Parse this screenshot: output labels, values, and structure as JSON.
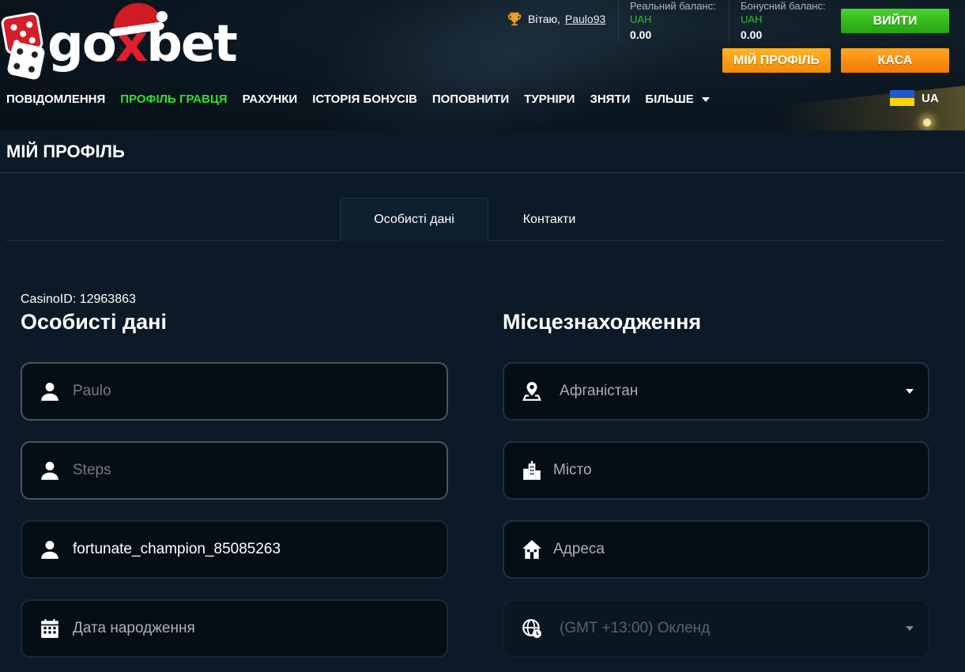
{
  "brand": {
    "name_left": "go",
    "name_x": "x",
    "name_right": "bet"
  },
  "header": {
    "greeting": "Вітаю,",
    "username": "Paulo93",
    "real_balance": {
      "label": "Реальний баланс:",
      "currency": "UAH",
      "amount": "0.00"
    },
    "bonus_balance": {
      "label": "Бонусний баланс:",
      "currency": "UAH",
      "amount": "0.00"
    },
    "exit_label": "ВИЙТИ",
    "profile_label": "МІЙ ПРОФІЛЬ",
    "cash_label": "КАСА"
  },
  "nav": {
    "items": [
      {
        "label": "ПОВІДОМЛЕННЯ"
      },
      {
        "label": "ПРОФІЛЬ ГРАВЦЯ"
      },
      {
        "label": "РАХУНКИ"
      },
      {
        "label": "ІСТОРІЯ БОНУСІВ"
      },
      {
        "label": "ПОПОВНИТИ"
      },
      {
        "label": "ТУРНІРИ"
      },
      {
        "label": "ЗНЯТИ"
      },
      {
        "label": "БІЛЬШЕ"
      }
    ],
    "active_index": 1,
    "language": "UA"
  },
  "page": {
    "title": "МІЙ ПРОФІЛЬ"
  },
  "tabs": [
    {
      "label": "Особисті дані"
    },
    {
      "label": "Контакти"
    }
  ],
  "personal": {
    "casino_id": "CasinoID: 12963863",
    "title": "Особисті дані",
    "first_name_placeholder": "Paulo",
    "last_name_placeholder": "Steps",
    "nickname_value": "fortunate_champion_85085263",
    "birthdate_placeholder": "Дата народження"
  },
  "location": {
    "title": "Місцезнаходження",
    "country_value": "Афганістан",
    "city_placeholder": "Місто",
    "address_placeholder": "Адреса",
    "timezone_value": "(GMT +13:00) Окленд"
  },
  "colors": {
    "accent_green": "#2fe02f",
    "exit_button": "#36bd1e",
    "orange_button": "#f7a01a",
    "background": "#0b1a26"
  }
}
